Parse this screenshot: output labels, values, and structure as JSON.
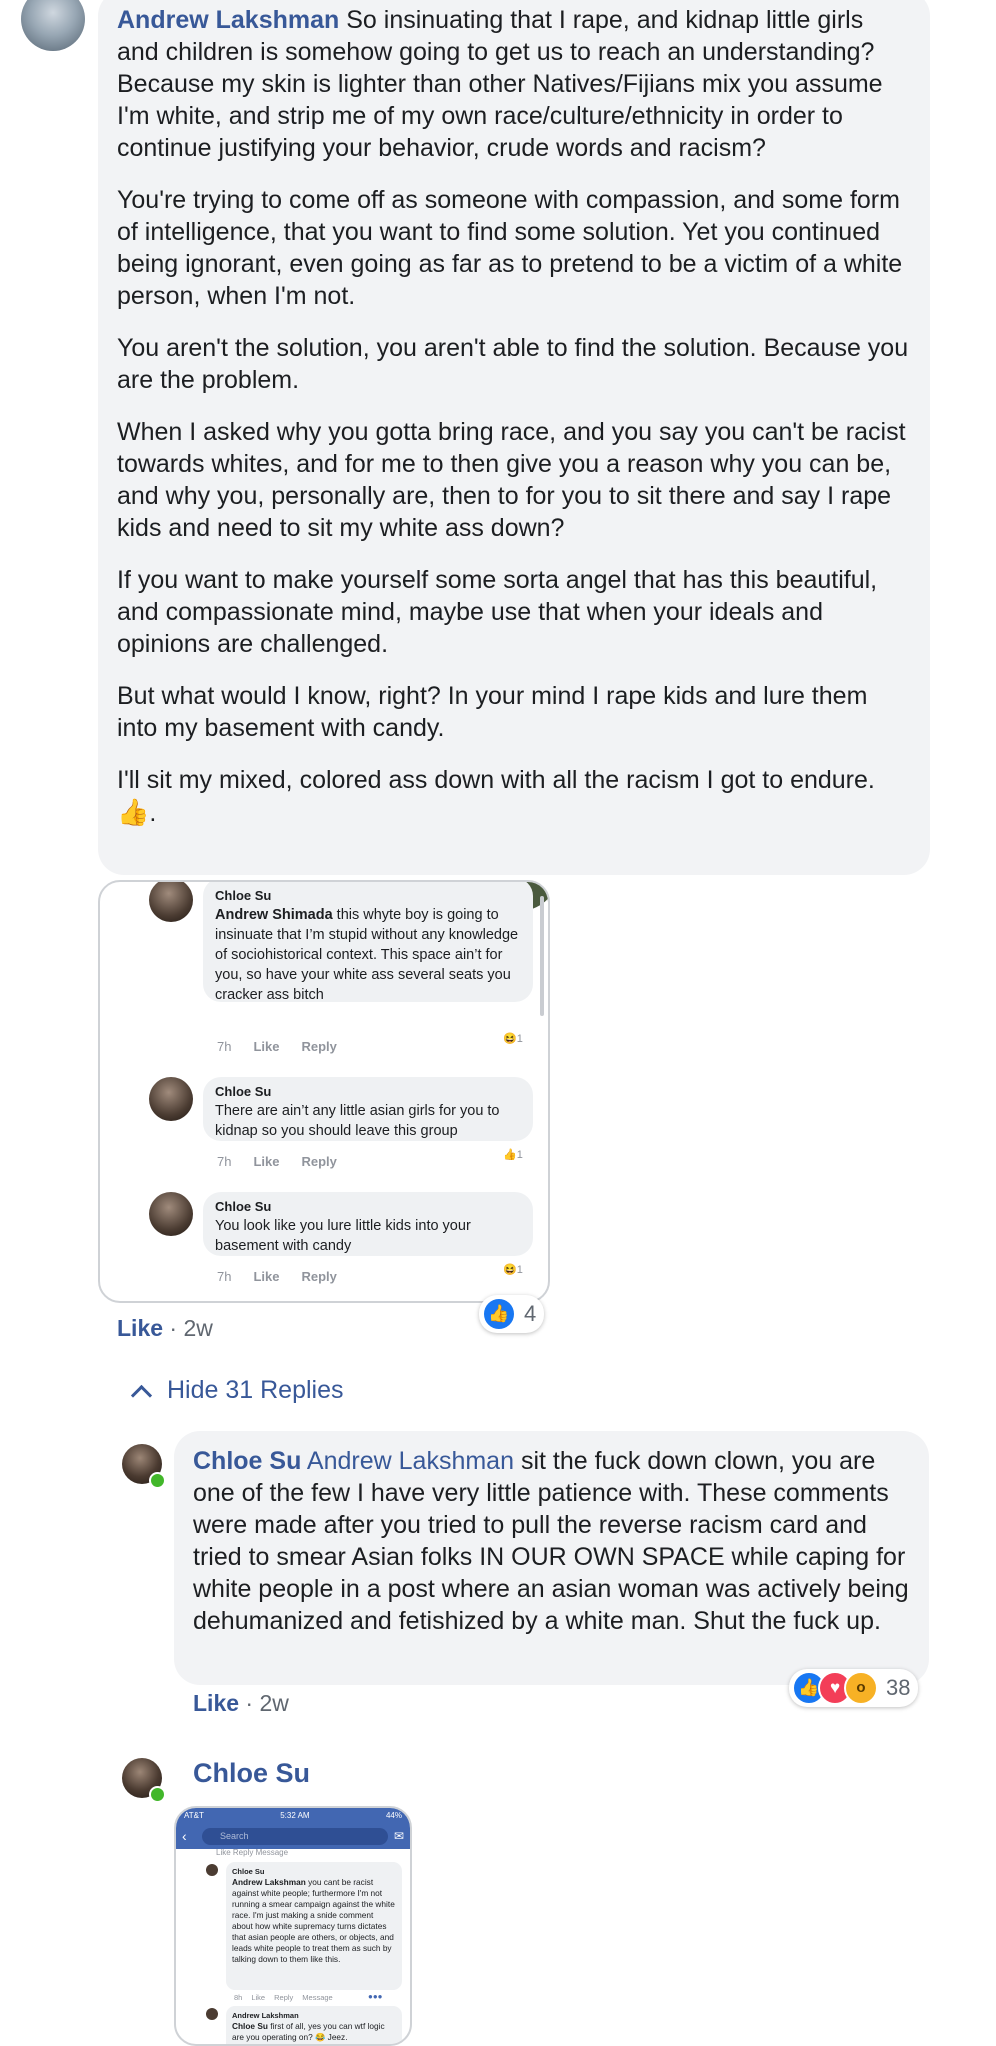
{
  "comment1": {
    "author": "Andrew Lakshman",
    "paragraphs": [
      "So insinuating that I rape, and kidnap little girls and children is somehow going to get us to reach an understanding? Because my skin is lighter than other Natives/Fijians mix you assume I'm white, and strip me of my own race/culture/ethnicity in order to continue justifying your behavior, crude words and racism?",
      "You're trying to come off as someone with compassion, and some form of intelligence, that you want to find some solution. Yet you continued being ignorant, even going as far as to pretend to be a victim of a white person, when I'm not.",
      "You aren't the solution, you aren't able to find the solution. Because you are the problem.",
      "When I asked why you gotta bring race, and you say you can't be racist towards whites, and for me to then give you a reason why you can be, and why you, personally are, then to for you to sit there and say I rape kids and need to sit my white ass down?",
      "If you want to make yourself some sorta angel that has this beautiful, and compassionate mind, maybe use that when your ideals and opinions are challenged.",
      "But what would I know, right? In your mind I rape kids and lure them into my basement with candy.",
      "I'll sit my mixed, colored ass down with all the racism I got to endure."
    ],
    "end_emoji": "👍",
    "end_punct": ".",
    "like_label": "Like",
    "time": "2w",
    "reaction_count": "4"
  },
  "screenshot1": {
    "comments": [
      {
        "name": "Chloe Su",
        "mention": "Andrew Shimada",
        "text": "this whyte boy is going to insinuate that I’m stupid without any knowledge of sociohistorical context. This space ain’t for you, so have your white ass several seats you cracker ass bitch",
        "time": "7h",
        "like": "Like",
        "reply": "Reply",
        "reaction": "1"
      },
      {
        "name": "Chloe Su",
        "text": "There are ain’t any little asian girls for you to kidnap so you should leave this group",
        "time": "7h",
        "like": "Like",
        "reply": "Reply",
        "reaction": "1"
      },
      {
        "name": "Chloe Su",
        "text": "You look like you lure little kids into your basement with candy",
        "time": "7h",
        "like": "Like",
        "reply": "Reply",
        "reaction": "1"
      }
    ]
  },
  "hide_replies": "Hide 31 Replies",
  "reply1": {
    "author": "Chloe Su",
    "mention": "Andrew Lakshman",
    "text": "sit the fuck down clown, you are one of the few I have very little patience with. These comments were made after you tried to pull the reverse racism card and tried to smear Asian folks IN OUR OWN SPACE while caping for white people in a post where an asian woman was actively being dehumanized and fetishized by a white man. Shut the fuck up.",
    "like_label": "Like",
    "time": "2w",
    "reaction_count": "38"
  },
  "reply2": {
    "author": "Chloe Su"
  },
  "screenshot2": {
    "status_left": "AT&T",
    "status_time": "5:32 AM",
    "status_right": "44%",
    "search_placeholder": "Search",
    "cut_text": "Like Reply Message",
    "comments": [
      {
        "name": "Chloe Su",
        "mention": "Andrew Lakshman",
        "text": "you cant be racist against white people; furthermore I'm not running a smear campaign against the white race. I'm just making a snide comment about how white supremacy turns dictates that asian people are others, or objects, and leads white people to treat them as such by talking down to them like this.",
        "time": "8h",
        "like": "Like",
        "reply": "Reply",
        "message": "Message"
      },
      {
        "name": "Andrew Lakshman",
        "mention": "Chloe Su",
        "text": "first of all, yes you can wtf logic are you operating on? 😂 Jeez."
      }
    ]
  },
  "colors": {
    "link": "#385898",
    "bubble": "#f2f3f5",
    "like_blue": "#1877f2",
    "online": "#42b72a"
  }
}
